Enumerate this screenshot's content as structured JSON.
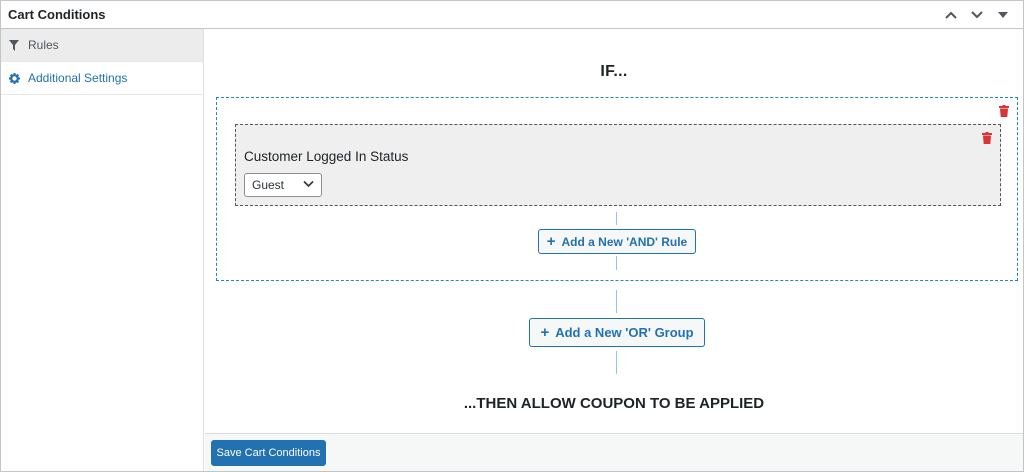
{
  "panel": {
    "title": "Cart Conditions"
  },
  "sidebar": {
    "items": [
      {
        "label": "Rules",
        "icon": "filter-icon"
      },
      {
        "label": "Additional Settings",
        "icon": "gear-icon"
      }
    ]
  },
  "main": {
    "if_label": "IF...",
    "group": {
      "rule": {
        "label": "Customer Logged In Status",
        "selected": "Guest"
      },
      "add_and_label": "Add a New 'AND' Rule"
    },
    "add_or_label": "Add a New 'OR' Group",
    "then_label": "...THEN ALLOW COUPON TO BE APPLIED"
  },
  "footer": {
    "save_label": "Save Cart Conditions"
  },
  "colors": {
    "accent": "#2271b1",
    "group_border": "#1d8ea8",
    "trash": "#d63638"
  }
}
